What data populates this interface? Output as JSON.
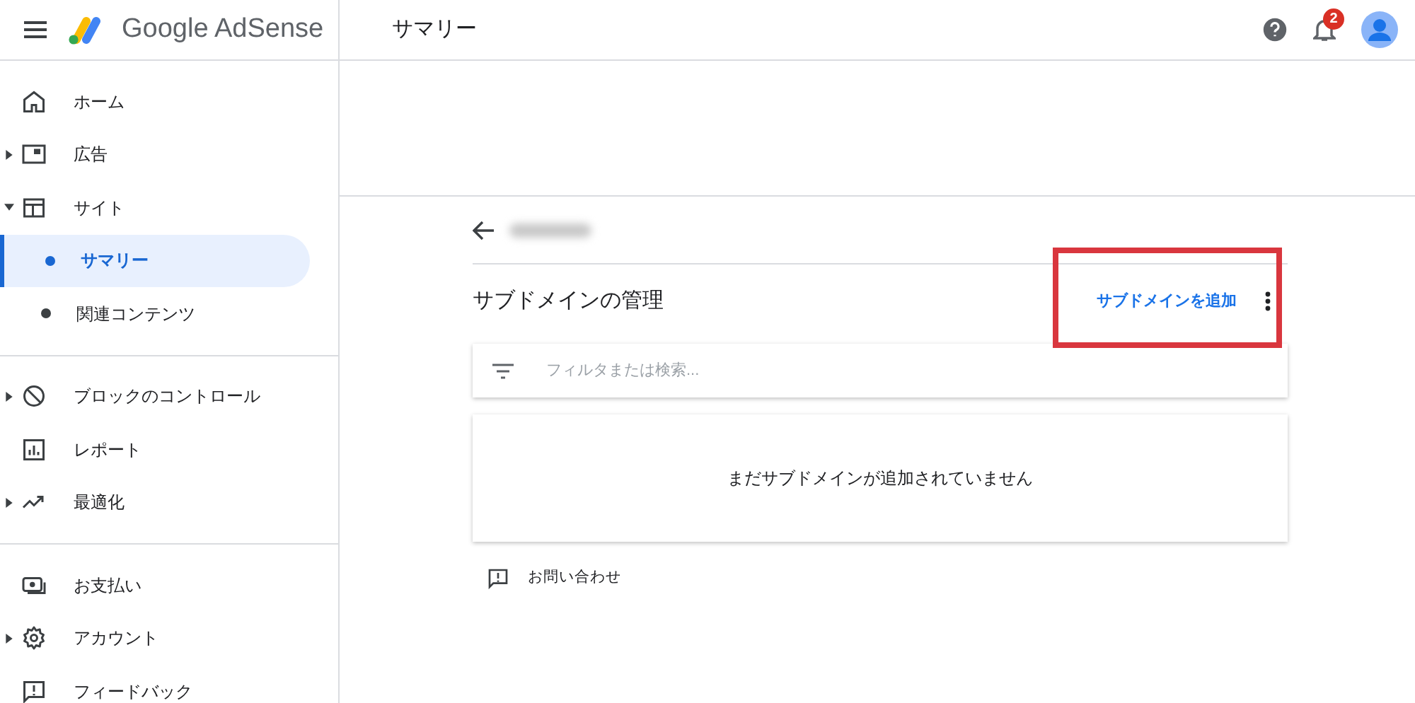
{
  "header": {
    "brand": "Google AdSense",
    "page_title": "サマリー",
    "notifications": "2"
  },
  "sidebar": {
    "sections": [
      [
        {
          "label": "ホーム"
        },
        {
          "label": "広告",
          "expanded": false
        },
        {
          "label": "サイト",
          "expanded": true,
          "children": [
            {
              "label": "サマリー",
              "selected": true
            },
            {
              "label": "関連コンテンツ",
              "selected": false
            }
          ]
        }
      ],
      [
        {
          "label": "ブロックのコントロール",
          "expanded": false
        },
        {
          "label": "レポート"
        },
        {
          "label": "最適化",
          "expanded": false
        }
      ],
      [
        {
          "label": "お支払い"
        },
        {
          "label": "アカウント",
          "expanded": false
        },
        {
          "label": "フィードバック"
        }
      ]
    ]
  },
  "content": {
    "heading": "サブドメインの管理",
    "add_button": "サブドメインを追加",
    "search": {
      "placeholder": "フィルタまたは検索..."
    },
    "empty_message": "まだサブドメインが追加されていません",
    "contact_link": "お問い合わせ"
  }
}
